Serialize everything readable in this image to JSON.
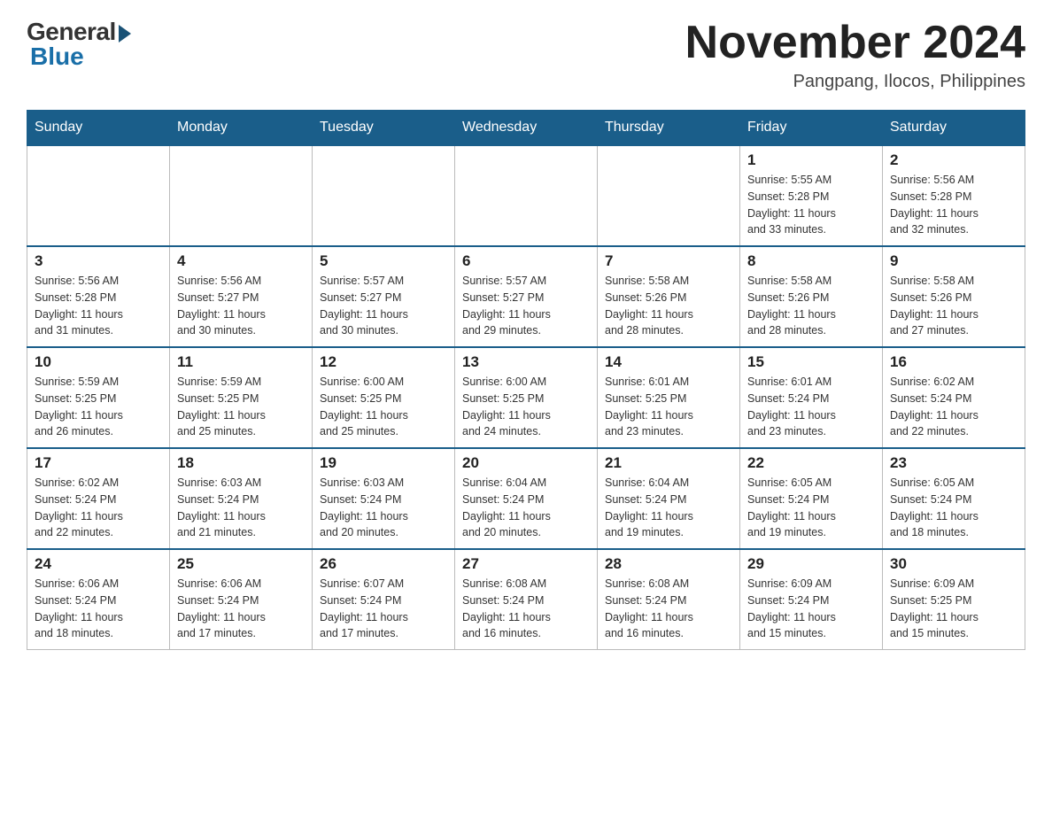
{
  "header": {
    "logo_general": "General",
    "logo_blue": "Blue",
    "month_title": "November 2024",
    "subtitle": "Pangpang, Ilocos, Philippines"
  },
  "weekdays": [
    "Sunday",
    "Monday",
    "Tuesday",
    "Wednesday",
    "Thursday",
    "Friday",
    "Saturday"
  ],
  "weeks": [
    [
      {
        "day": "",
        "info": ""
      },
      {
        "day": "",
        "info": ""
      },
      {
        "day": "",
        "info": ""
      },
      {
        "day": "",
        "info": ""
      },
      {
        "day": "",
        "info": ""
      },
      {
        "day": "1",
        "info": "Sunrise: 5:55 AM\nSunset: 5:28 PM\nDaylight: 11 hours\nand 33 minutes."
      },
      {
        "day": "2",
        "info": "Sunrise: 5:56 AM\nSunset: 5:28 PM\nDaylight: 11 hours\nand 32 minutes."
      }
    ],
    [
      {
        "day": "3",
        "info": "Sunrise: 5:56 AM\nSunset: 5:28 PM\nDaylight: 11 hours\nand 31 minutes."
      },
      {
        "day": "4",
        "info": "Sunrise: 5:56 AM\nSunset: 5:27 PM\nDaylight: 11 hours\nand 30 minutes."
      },
      {
        "day": "5",
        "info": "Sunrise: 5:57 AM\nSunset: 5:27 PM\nDaylight: 11 hours\nand 30 minutes."
      },
      {
        "day": "6",
        "info": "Sunrise: 5:57 AM\nSunset: 5:27 PM\nDaylight: 11 hours\nand 29 minutes."
      },
      {
        "day": "7",
        "info": "Sunrise: 5:58 AM\nSunset: 5:26 PM\nDaylight: 11 hours\nand 28 minutes."
      },
      {
        "day": "8",
        "info": "Sunrise: 5:58 AM\nSunset: 5:26 PM\nDaylight: 11 hours\nand 28 minutes."
      },
      {
        "day": "9",
        "info": "Sunrise: 5:58 AM\nSunset: 5:26 PM\nDaylight: 11 hours\nand 27 minutes."
      }
    ],
    [
      {
        "day": "10",
        "info": "Sunrise: 5:59 AM\nSunset: 5:25 PM\nDaylight: 11 hours\nand 26 minutes."
      },
      {
        "day": "11",
        "info": "Sunrise: 5:59 AM\nSunset: 5:25 PM\nDaylight: 11 hours\nand 25 minutes."
      },
      {
        "day": "12",
        "info": "Sunrise: 6:00 AM\nSunset: 5:25 PM\nDaylight: 11 hours\nand 25 minutes."
      },
      {
        "day": "13",
        "info": "Sunrise: 6:00 AM\nSunset: 5:25 PM\nDaylight: 11 hours\nand 24 minutes."
      },
      {
        "day": "14",
        "info": "Sunrise: 6:01 AM\nSunset: 5:25 PM\nDaylight: 11 hours\nand 23 minutes."
      },
      {
        "day": "15",
        "info": "Sunrise: 6:01 AM\nSunset: 5:24 PM\nDaylight: 11 hours\nand 23 minutes."
      },
      {
        "day": "16",
        "info": "Sunrise: 6:02 AM\nSunset: 5:24 PM\nDaylight: 11 hours\nand 22 minutes."
      }
    ],
    [
      {
        "day": "17",
        "info": "Sunrise: 6:02 AM\nSunset: 5:24 PM\nDaylight: 11 hours\nand 22 minutes."
      },
      {
        "day": "18",
        "info": "Sunrise: 6:03 AM\nSunset: 5:24 PM\nDaylight: 11 hours\nand 21 minutes."
      },
      {
        "day": "19",
        "info": "Sunrise: 6:03 AM\nSunset: 5:24 PM\nDaylight: 11 hours\nand 20 minutes."
      },
      {
        "day": "20",
        "info": "Sunrise: 6:04 AM\nSunset: 5:24 PM\nDaylight: 11 hours\nand 20 minutes."
      },
      {
        "day": "21",
        "info": "Sunrise: 6:04 AM\nSunset: 5:24 PM\nDaylight: 11 hours\nand 19 minutes."
      },
      {
        "day": "22",
        "info": "Sunrise: 6:05 AM\nSunset: 5:24 PM\nDaylight: 11 hours\nand 19 minutes."
      },
      {
        "day": "23",
        "info": "Sunrise: 6:05 AM\nSunset: 5:24 PM\nDaylight: 11 hours\nand 18 minutes."
      }
    ],
    [
      {
        "day": "24",
        "info": "Sunrise: 6:06 AM\nSunset: 5:24 PM\nDaylight: 11 hours\nand 18 minutes."
      },
      {
        "day": "25",
        "info": "Sunrise: 6:06 AM\nSunset: 5:24 PM\nDaylight: 11 hours\nand 17 minutes."
      },
      {
        "day": "26",
        "info": "Sunrise: 6:07 AM\nSunset: 5:24 PM\nDaylight: 11 hours\nand 17 minutes."
      },
      {
        "day": "27",
        "info": "Sunrise: 6:08 AM\nSunset: 5:24 PM\nDaylight: 11 hours\nand 16 minutes."
      },
      {
        "day": "28",
        "info": "Sunrise: 6:08 AM\nSunset: 5:24 PM\nDaylight: 11 hours\nand 16 minutes."
      },
      {
        "day": "29",
        "info": "Sunrise: 6:09 AM\nSunset: 5:24 PM\nDaylight: 11 hours\nand 15 minutes."
      },
      {
        "day": "30",
        "info": "Sunrise: 6:09 AM\nSunset: 5:25 PM\nDaylight: 11 hours\nand 15 minutes."
      }
    ]
  ]
}
